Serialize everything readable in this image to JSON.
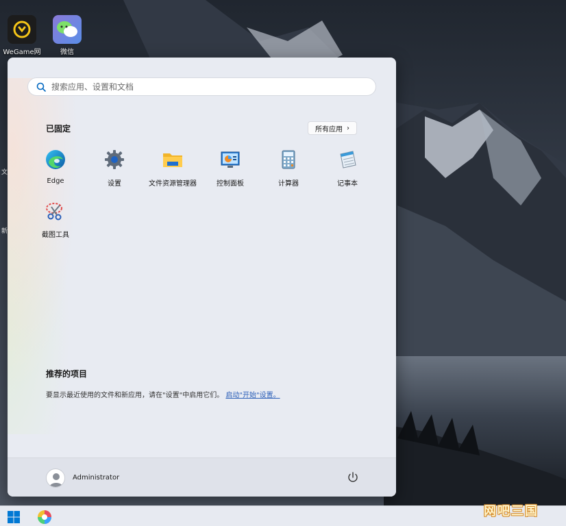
{
  "desktop": {
    "icons": [
      {
        "label": "WeGame网"
      },
      {
        "label": "微信"
      }
    ],
    "edge_text_1": "文",
    "edge_text_2": "新"
  },
  "start_menu": {
    "search": {
      "placeholder": "搜索应用、设置和文档",
      "value": ""
    },
    "pinned_title": "已固定",
    "all_apps_label": "所有应用",
    "all_apps_chevron": "›",
    "pinned_apps": [
      {
        "label": "Edge",
        "icon": "edge-icon"
      },
      {
        "label": "设置",
        "icon": "gear-icon"
      },
      {
        "label": "文件资源管理器",
        "icon": "folder-icon"
      },
      {
        "label": "控制面板",
        "icon": "control-panel-icon"
      },
      {
        "label": "计算器",
        "icon": "calculator-icon"
      },
      {
        "label": "记事本",
        "icon": "notepad-icon"
      },
      {
        "label": "截图工具",
        "icon": "snipping-tool-icon"
      }
    ],
    "recommended": {
      "title": "推荐的项目",
      "text": "要显示最近使用的文件和新应用，请在\"设置\"中启用它们。",
      "link": "启动\"开始\"设置。"
    },
    "user": {
      "name": "Administrator"
    }
  },
  "watermark": "网吧三国",
  "colors": {
    "accent": "#0067c0",
    "link": "#2b5fb8",
    "menu_bg": "#e8ebf2"
  }
}
